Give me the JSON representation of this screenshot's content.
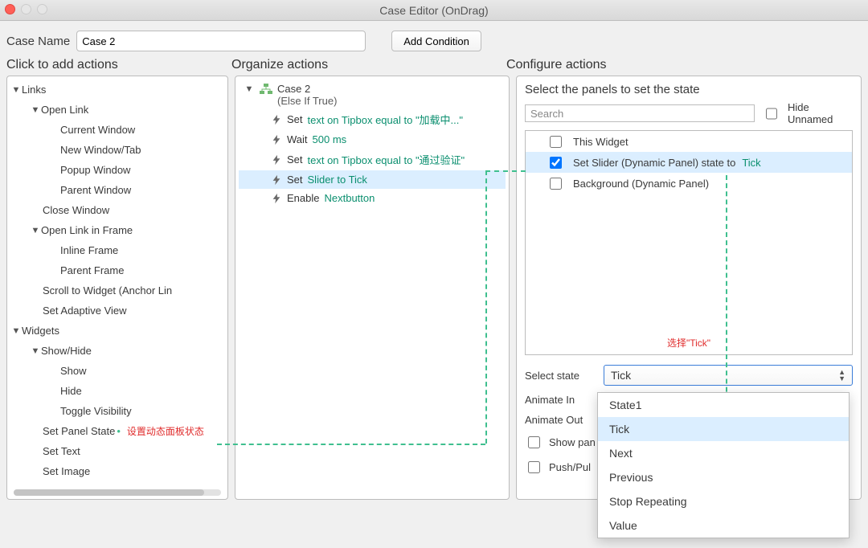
{
  "window": {
    "title": "Case Editor (OnDrag)"
  },
  "caseName": {
    "label": "Case Name",
    "value": "Case 2"
  },
  "buttons": {
    "addCondition": "Add Condition"
  },
  "headers": {
    "click": "Click to add actions",
    "organize": "Organize actions",
    "configure": "Configure actions"
  },
  "actionTree": {
    "links": {
      "label": "Links",
      "openLink": {
        "label": "Open Link",
        "items": [
          "Current Window",
          "New Window/Tab",
          "Popup Window",
          "Parent Window"
        ]
      },
      "closeWindow": "Close Window",
      "openLinkFrame": {
        "label": "Open Link in Frame",
        "items": [
          "Inline Frame",
          "Parent Frame"
        ]
      },
      "scrollWidget": "Scroll to Widget (Anchor Lin",
      "setAdaptive": "Set Adaptive View"
    },
    "widgets": {
      "label": "Widgets",
      "showHide": {
        "label": "Show/Hide",
        "items": [
          "Show",
          "Hide",
          "Toggle Visibility"
        ]
      },
      "setPanelState": "Set Panel State",
      "setPanelStateNote": "设置动态面板状态",
      "setText": "Set Text",
      "setImage": "Set Image"
    }
  },
  "organize": {
    "caseTitle": "Case 2",
    "caseSub": "(Else If True)",
    "actions": [
      {
        "key": "Set ",
        "val": "text on Tipbox equal to \"加载中...\""
      },
      {
        "key": "Wait ",
        "val": "500 ms"
      },
      {
        "key": "Set ",
        "val": "text on Tipbox equal to \"通过验证\""
      },
      {
        "key": "Set ",
        "val": "Slider to Tick",
        "selected": true
      },
      {
        "key": "Enable ",
        "val": "Nextbutton"
      }
    ]
  },
  "configure": {
    "title": "Select the panels to set the state",
    "searchPlaceholder": "Search",
    "hideUnnamed": "Hide Unnamed",
    "panels": [
      {
        "label": "This Widget",
        "checked": false
      },
      {
        "label": "Set Slider (Dynamic Panel) state to ",
        "suffix": "Tick",
        "checked": true,
        "selected": true
      },
      {
        "label": "Background (Dynamic Panel)",
        "checked": false
      }
    ],
    "panelNote": "选择\"Tick\"",
    "selectState": {
      "label": "Select state",
      "value": "Tick"
    },
    "animateIn": "Animate In",
    "animateOut": "Animate Out",
    "showPanel": "Show pan",
    "pushPull": "Push/Pul",
    "dropdown": [
      "State1",
      "Tick",
      "Next",
      "Previous",
      "Stop Repeating",
      "Value"
    ],
    "dropdownSelected": "Tick"
  }
}
